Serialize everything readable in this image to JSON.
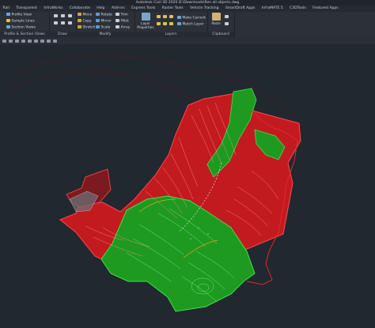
{
  "window": {
    "title": "Autodesk Civil 3D 2020   D:\\Downloads\\Ren all objects.dwg"
  },
  "menu": {
    "items": [
      "Rail",
      "Transparent",
      "InfraWorks",
      "Collaborate",
      "Help",
      "Add-ins",
      "Express Tools",
      "Raster Tools",
      "Vehicle Tracking",
      "SmartDraft Apps",
      "InfraMATE 5",
      "C3DTools",
      "Featured Apps"
    ]
  },
  "ribbon": {
    "profile_section": {
      "title": "Profile & Section Views",
      "items": [
        "Profile View",
        "Sample Lines",
        "Section Views"
      ]
    },
    "draw": {
      "title": "Draw"
    },
    "modify": {
      "title": "Modify",
      "items": [
        "Move",
        "Rotate",
        "Trim",
        "Copy",
        "Mirror",
        "Fillet",
        "Stretch",
        "Scale",
        "Array"
      ]
    },
    "layers": {
      "title": "Layers",
      "layer_properties_label": "Layer Properties",
      "items": [
        "Make Current",
        "Match Layer"
      ]
    },
    "clipboard": {
      "title": "Clipboard",
      "paste_label": "Paste"
    }
  },
  "colors": {
    "red_surface": "#cf1b22",
    "green_surface": "#1f9a22",
    "background": "#212830",
    "ribbon": "#2c3139"
  }
}
